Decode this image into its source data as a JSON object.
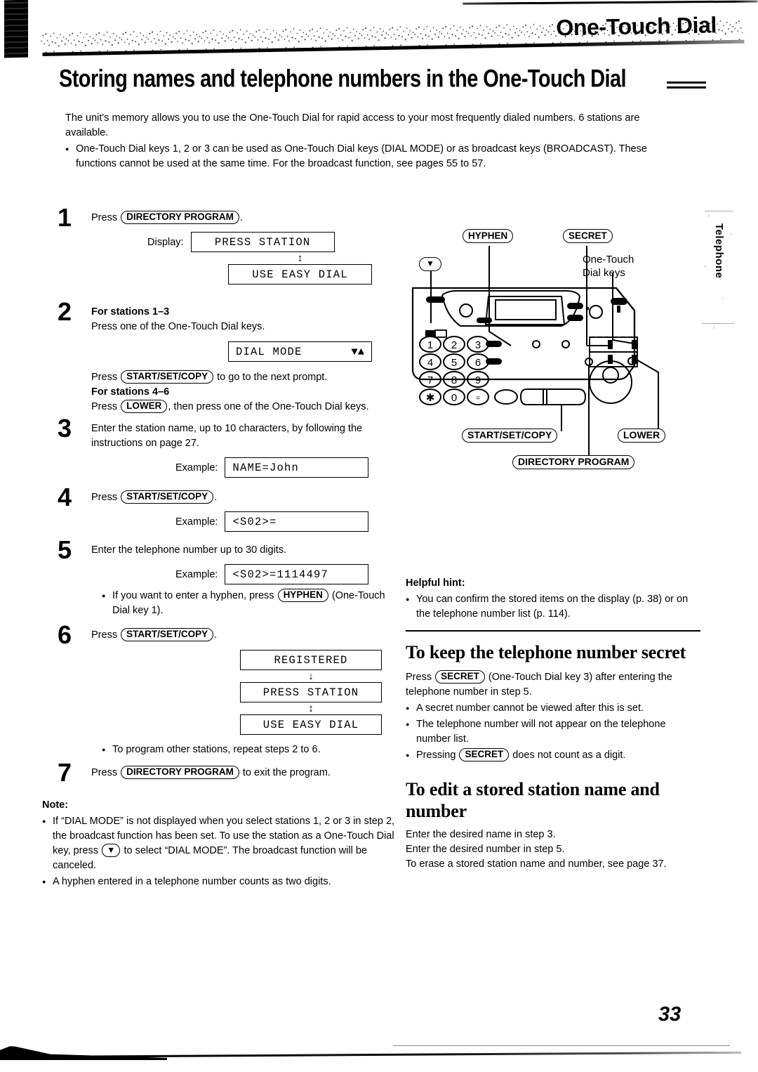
{
  "banner": {
    "chapter_title": "One-Touch Dial"
  },
  "side_tab": {
    "label": "Telephone"
  },
  "page_number": "33",
  "heading": {
    "main_title": "Storing names and telephone numbers in the One-Touch Dial"
  },
  "intro": {
    "paragraph": "The unit's memory allows you to use the One-Touch Dial for rapid access to your most frequently dialed numbers. 6 stations are available.",
    "bullet": "One-Touch Dial keys 1, 2 or 3 can be used as One-Touch Dial keys (DIAL MODE) or as broadcast keys (BROADCAST). These functions cannot be used at the same time. For the broadcast function, see pages 55 to 57."
  },
  "steps": {
    "s1": {
      "num": "1",
      "press_word": "Press",
      "key": "DIRECTORY PROGRAM",
      "period": ".",
      "display_label": "Display:",
      "lcd_1": "PRESS STATION",
      "arrow": "↕",
      "lcd_2": "USE EASY DIAL"
    },
    "s2": {
      "num": "2",
      "sub_a": "For stations 1–3",
      "line_a": "Press one of the One-Touch Dial keys.",
      "lcd_1": "DIAL MODE",
      "lcd_1_glyph": "▼▲",
      "press_word": "Press",
      "key_sscopy": "START/SET/COPY",
      "line_b_tail": "to go to the next prompt.",
      "sub_b": "For stations 4–6",
      "line_c_head": "Press",
      "key_lower": "LOWER",
      "line_c_tail": ", then press one of the One-Touch Dial keys."
    },
    "s3": {
      "num": "3",
      "text": "Enter the station name, up to 10 characters, by following the instructions on page 27.",
      "example_label": "Example:",
      "lcd": "NAME=John"
    },
    "s4": {
      "num": "4",
      "press_word": "Press",
      "key": "START/SET/COPY",
      "period": ".",
      "example_label": "Example:",
      "lcd": "<S02>="
    },
    "s5": {
      "num": "5",
      "text": "Enter the telephone number up to 30 digits.",
      "example_label": "Example:",
      "lcd": "<S02>=1114497",
      "bullet_head": "If you want to enter a hyphen, press",
      "bullet_key": "HYPHEN",
      "bullet_tail": "(One-Touch Dial key 1)."
    },
    "s6": {
      "num": "6",
      "press_word": "Press",
      "key": "START/SET/COPY",
      "period": ".",
      "lcd_1": "REGISTERED",
      "arrow_1": "↓",
      "lcd_2": "PRESS STATION",
      "arrow_2": "↕",
      "lcd_3": "USE EASY DIAL",
      "bullet": "To program other stations, repeat steps 2 to 6."
    },
    "s7": {
      "num": "7",
      "press_word": "Press",
      "key": "DIRECTORY PROGRAM",
      "tail": "to exit the program."
    }
  },
  "note": {
    "title": "Note:",
    "b1_part1": "If “DIAL MODE” is not displayed when you select stations 1, 2 or 3 in step 2, the broadcast function has been set. To use the station as a One-Touch Dial key, press",
    "b1_key": "▼",
    "b1_part2": "to select “DIAL MODE”. The broadcast function will be canceled.",
    "b2": "A hyphen entered in a telephone number counts as two digits."
  },
  "diagram": {
    "callouts": {
      "hyphen": "HYPHEN",
      "secret": "SECRET",
      "down_arrow": "▼",
      "start_set_copy": "START/SET/COPY",
      "lower": "LOWER",
      "directory_program": "DIRECTORY PROGRAM"
    },
    "annotation": {
      "line1": "One-Touch",
      "line2": "Dial keys"
    },
    "keypad": [
      "1",
      "2",
      "3",
      "4",
      "5",
      "6",
      "7",
      "8",
      "9",
      "✳",
      "0",
      "□"
    ]
  },
  "helpful_hint": {
    "title": "Helpful hint:",
    "bullet": "You can confirm the stored items on the display (p. 38) or on the telephone number list (p. 114)."
  },
  "secret_section": {
    "heading": "To keep the telephone number secret",
    "intro_head": "Press",
    "intro_key": "SECRET",
    "intro_tail": "(One-Touch Dial key 3) after entering the telephone number in step 5.",
    "b1": "A secret number cannot be viewed after this is set.",
    "b2": "The telephone number will not appear on the telephone number list.",
    "b3_head": "Pressing",
    "b3_key": "SECRET",
    "b3_tail": "does not count as a digit."
  },
  "edit_section": {
    "heading": "To edit a stored station name and number",
    "l1": "Enter the desired name in step 3.",
    "l2": "Enter the desired number in step 5.",
    "l3": "To erase a stored station name and number, see page 37."
  }
}
